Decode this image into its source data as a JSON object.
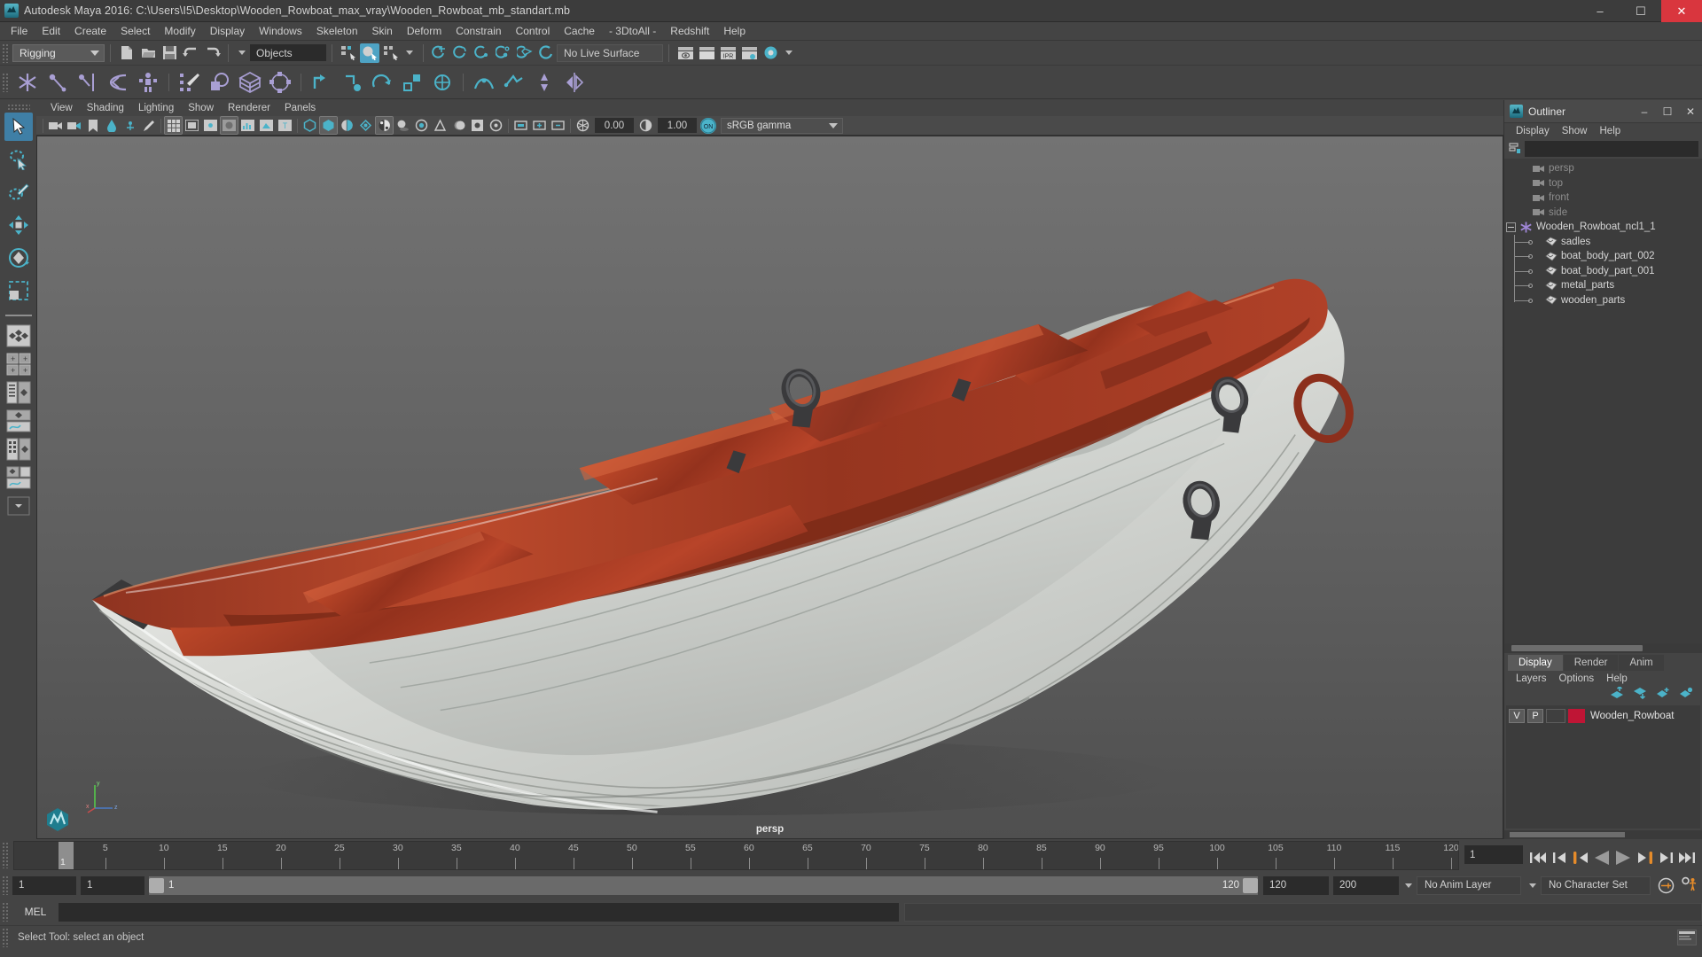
{
  "window": {
    "title": "Autodesk Maya 2016: C:\\Users\\I5\\Desktop\\Wooden_Rowboat_max_vray\\Wooden_Rowboat_mb_standart.mb",
    "app_icon": "maya-icon",
    "minimize_label": "–",
    "maximize_label": "☐",
    "close_label": "✕"
  },
  "menubar": {
    "items": [
      {
        "label": "File"
      },
      {
        "label": "Edit"
      },
      {
        "label": "Create"
      },
      {
        "label": "Select"
      },
      {
        "label": "Modify"
      },
      {
        "label": "Display"
      },
      {
        "label": "Windows"
      },
      {
        "label": "Skeleton"
      },
      {
        "label": "Skin"
      },
      {
        "label": "Deform"
      },
      {
        "label": "Constrain"
      },
      {
        "label": "Control"
      },
      {
        "label": "Cache"
      },
      {
        "label": "- 3DtoAll -"
      },
      {
        "label": "Redshift"
      },
      {
        "label": "Help"
      }
    ]
  },
  "statusline": {
    "menuset": "Rigging",
    "selection_mask": "Objects",
    "live_surface": "No Live Surface"
  },
  "viewport_menu": {
    "items": [
      {
        "label": "View"
      },
      {
        "label": "Shading"
      },
      {
        "label": "Lighting"
      },
      {
        "label": "Show"
      },
      {
        "label": "Renderer"
      },
      {
        "label": "Panels"
      }
    ]
  },
  "viewport_toolbar": {
    "exposure_value": "0.00",
    "gamma_value": "1.00",
    "color_management_toggle": "ON",
    "color_profile": "sRGB gamma"
  },
  "viewport": {
    "camera_label": "persp",
    "axis_x": "x",
    "axis_y": "y",
    "axis_z": "z"
  },
  "outliner": {
    "title": "Outliner",
    "minimize_label": "–",
    "maximize_label": "☐",
    "close_label": "✕",
    "menu": [
      {
        "label": "Display"
      },
      {
        "label": "Show"
      },
      {
        "label": "Help"
      }
    ],
    "search_placeholder": "",
    "search_value": "",
    "tree": [
      {
        "label": "persp",
        "type": "camera",
        "level": 0,
        "dim": true
      },
      {
        "label": "top",
        "type": "camera",
        "level": 0,
        "dim": true
      },
      {
        "label": "front",
        "type": "camera",
        "level": 0,
        "dim": true
      },
      {
        "label": "side",
        "type": "camera",
        "level": 0,
        "dim": true
      },
      {
        "label": "Wooden_Rowboat_ncl1_1",
        "type": "group",
        "level": 0,
        "dim": false,
        "expanded": true
      },
      {
        "label": "sadles",
        "type": "mesh",
        "level": 1,
        "dim": false
      },
      {
        "label": "boat_body_part_002",
        "type": "mesh",
        "level": 1,
        "dim": false
      },
      {
        "label": "boat_body_part_001",
        "type": "mesh",
        "level": 1,
        "dim": false
      },
      {
        "label": "metal_parts",
        "type": "mesh",
        "level": 1,
        "dim": false
      },
      {
        "label": "wooden_parts",
        "type": "mesh",
        "level": 1,
        "dim": false
      }
    ]
  },
  "layer_editor": {
    "tabs": [
      {
        "label": "Display",
        "active": true
      },
      {
        "label": "Render",
        "active": false
      },
      {
        "label": "Anim",
        "active": false
      }
    ],
    "menu": [
      {
        "label": "Layers"
      },
      {
        "label": "Options"
      },
      {
        "label": "Help"
      }
    ],
    "layers": [
      {
        "visibility": "V",
        "playback": "P",
        "state": "",
        "color": "#bf1535",
        "name": "Wooden_Rowboat"
      }
    ]
  },
  "timeline": {
    "ticks": [
      "5",
      "10",
      "15",
      "20",
      "25",
      "30",
      "35",
      "40",
      "45",
      "50",
      "55",
      "60",
      "65",
      "70",
      "75",
      "80",
      "85",
      "90",
      "95",
      "100",
      "105",
      "110",
      "115",
      "120"
    ],
    "start": 1,
    "end": 120,
    "playhead_frame": "1",
    "current_frame_value": "1",
    "transport": [
      {
        "name": "go-to-start-button",
        "glyph": "skip-back"
      },
      {
        "name": "step-back-key-button",
        "glyph": "prev-key"
      },
      {
        "name": "step-back-frame-button",
        "glyph": "prev-frame"
      },
      {
        "name": "play-backwards-button",
        "glyph": "play-back"
      },
      {
        "name": "play-forwards-button",
        "glyph": "play-fwd"
      },
      {
        "name": "step-forward-frame-button",
        "glyph": "next-frame"
      },
      {
        "name": "step-forward-key-button",
        "glyph": "next-key"
      },
      {
        "name": "go-to-end-button",
        "glyph": "skip-fwd"
      }
    ]
  },
  "range": {
    "anim_start": "1",
    "range_start": "1",
    "slider_start_label": "1",
    "slider_end_label": "120",
    "range_end": "120",
    "anim_end": "200",
    "anim_layer": "No Anim Layer",
    "character_set": "No Character Set"
  },
  "command_line": {
    "language": "MEL",
    "input_value": "",
    "output_value": ""
  },
  "status_bar": {
    "message": "Select Tool: select an object"
  },
  "toolbox": {
    "tools": [
      {
        "name": "select-tool",
        "active": true
      },
      {
        "name": "lasso-select-tool",
        "active": false
      },
      {
        "name": "paint-select-tool",
        "active": false
      },
      {
        "name": "move-tool",
        "active": false
      },
      {
        "name": "rotate-tool",
        "active": false
      },
      {
        "name": "scale-tool",
        "active": false
      }
    ],
    "layouts": [
      {
        "name": "single-perspective-layout"
      },
      {
        "name": "four-view-layout"
      },
      {
        "name": "outliner-persp-layout"
      },
      {
        "name": "persp-graph-layout"
      },
      {
        "name": "hypershade-persp-layout"
      },
      {
        "name": "persp-graph-outliner-layout"
      },
      {
        "name": "more-layouts-button"
      }
    ]
  },
  "colors": {
    "accent_teal": "#4bb3c9",
    "accent_purple": "#a99fd4",
    "layer_swatch": "#bf1535",
    "playhead": "#8e8e8e",
    "close_red": "#d9363e",
    "transport_orange": "#e58b2a"
  }
}
